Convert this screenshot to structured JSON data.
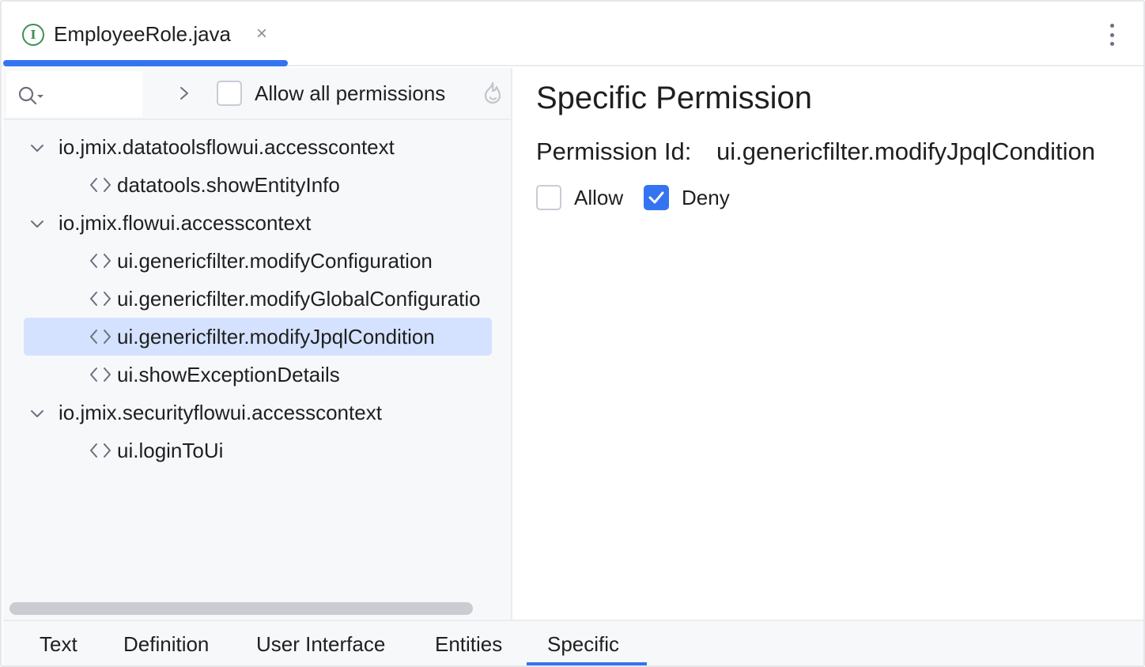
{
  "editor_tab": {
    "title": "EmployeeRole.java",
    "icon": "interface-icon",
    "close_glyph": "×"
  },
  "toolbar": {
    "allow_all_label": "Allow all permissions",
    "allow_all_checked": false
  },
  "tree": {
    "groups": [
      {
        "label": "io.jmix.datatoolsflowui.accesscontext",
        "expanded": true,
        "items": [
          "datatools.showEntityInfo"
        ]
      },
      {
        "label": "io.jmix.flowui.accesscontext",
        "expanded": true,
        "items": [
          "ui.genericfilter.modifyConfiguration",
          "ui.genericfilter.modifyGlobalConfiguratio",
          "ui.genericfilter.modifyJpqlCondition",
          "ui.showExceptionDetails"
        ]
      },
      {
        "label": "io.jmix.securityflowui.accesscontext",
        "expanded": true,
        "items": [
          "ui.loginToUi"
        ]
      }
    ],
    "selected_item": "ui.genericfilter.modifyJpqlCondition"
  },
  "detail": {
    "heading": "Specific Permission",
    "permission_id_label": "Permission Id:",
    "permission_id_value": "ui.genericfilter.modifyJpqlCondition",
    "allow_label": "Allow",
    "allow_checked": false,
    "deny_label": "Deny",
    "deny_checked": true
  },
  "bottom_tabs": {
    "text": "Text",
    "definition": "Definition",
    "user_interface": "User Interface",
    "entities": "Entities",
    "specific": "Specific",
    "active": "Specific"
  },
  "colors": {
    "accent": "#3574f0",
    "selection": "#d4e2ff",
    "panel_bg": "#f7f8fa",
    "interface_icon": "#3d8f58"
  }
}
